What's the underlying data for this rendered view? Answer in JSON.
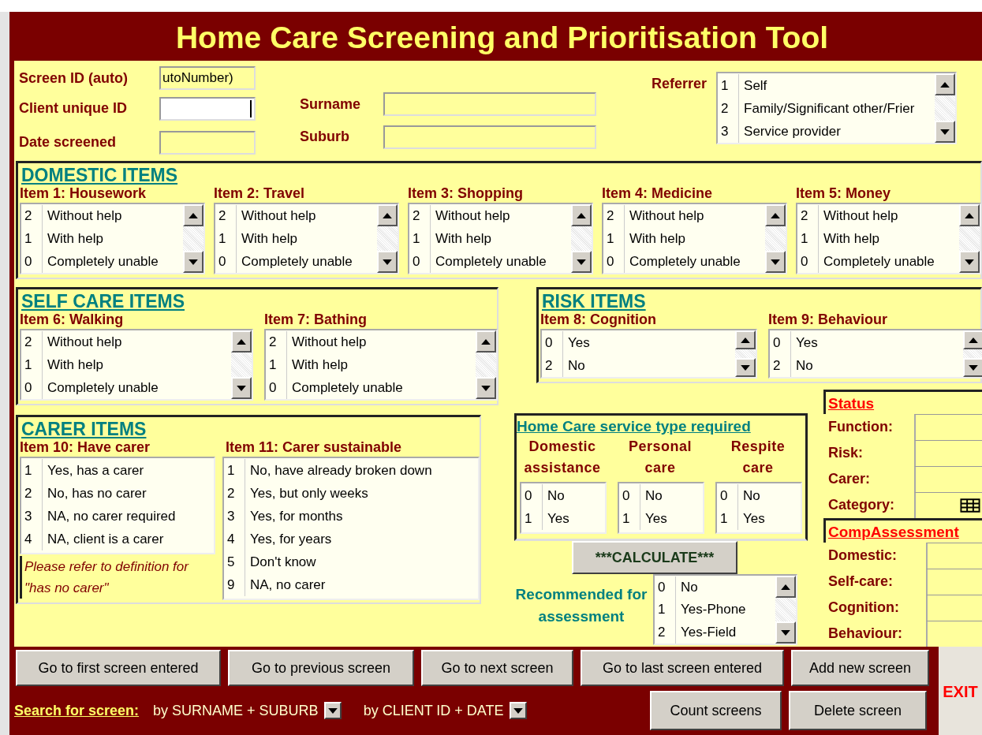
{
  "title": "Home Care Screening and Prioritisation Tool",
  "header": {
    "fields": [
      {
        "label": "Screen ID (auto)",
        "value": "utoNumber)",
        "focused": false
      },
      {
        "label": "Client unique ID",
        "focused": true
      },
      {
        "label": "Date screened",
        "focused": false
      }
    ],
    "name_fields": [
      {
        "label": "Surname"
      },
      {
        "label": "Suburb"
      }
    ],
    "referrer": {
      "label": "Referrer",
      "listbox": {
        "scrollbar": true,
        "options": [
          {
            "code": "1",
            "label": "Self",
            "selected": false
          },
          {
            "code": "2",
            "label": "Family/Significant other/Frier",
            "selected": false
          },
          {
            "code": "3",
            "label": "Service provider",
            "selected": false
          }
        ]
      }
    }
  },
  "domestic": {
    "title": "DOMESTIC ITEMS",
    "items": [
      {
        "label": "Item 1: Housework",
        "listbox": {
          "scrollbar": true,
          "options": [
            {
              "code": "2",
              "label": "Without help",
              "selected": false
            },
            {
              "code": "1",
              "label": "With help",
              "selected": false
            },
            {
              "code": "0",
              "label": "Completely unable",
              "selected": false
            }
          ]
        }
      },
      {
        "label": "Item 2: Travel",
        "listbox": {
          "scrollbar": true,
          "options": [
            {
              "code": "2",
              "label": "Without help",
              "selected": false
            },
            {
              "code": "1",
              "label": "With help",
              "selected": false
            },
            {
              "code": "0",
              "label": "Completely unable",
              "selected": false
            }
          ]
        }
      },
      {
        "label": "Item 3: Shopping",
        "listbox": {
          "scrollbar": true,
          "options": [
            {
              "code": "2",
              "label": "Without help",
              "selected": false
            },
            {
              "code": "1",
              "label": "With help",
              "selected": false
            },
            {
              "code": "0",
              "label": "Completely unable",
              "selected": false
            }
          ]
        }
      },
      {
        "label": "Item 4: Medicine",
        "listbox": {
          "scrollbar": true,
          "options": [
            {
              "code": "2",
              "label": "Without help",
              "selected": false
            },
            {
              "code": "1",
              "label": "With help",
              "selected": false
            },
            {
              "code": "0",
              "label": "Completely unable",
              "selected": false
            }
          ]
        }
      },
      {
        "label": "Item 5: Money",
        "listbox": {
          "scrollbar": true,
          "options": [
            {
              "code": "2",
              "label": "Without help",
              "selected": false
            },
            {
              "code": "1",
              "label": "With help",
              "selected": false
            },
            {
              "code": "0",
              "label": "Completely unable",
              "selected": false
            }
          ]
        }
      }
    ]
  },
  "self_care": {
    "title": "SELF CARE ITEMS",
    "items": [
      {
        "label": "Item 6: Walking",
        "listbox": {
          "scrollbar": true,
          "options": [
            {
              "code": "2",
              "label": "Without help",
              "selected": false
            },
            {
              "code": "1",
              "label": "With help",
              "selected": false
            },
            {
              "code": "0",
              "label": "Completely unable",
              "selected": false
            }
          ]
        }
      },
      {
        "label": "Item 7: Bathing",
        "listbox": {
          "scrollbar": true,
          "options": [
            {
              "code": "2",
              "label": "Without help",
              "selected": false
            },
            {
              "code": "1",
              "label": "With help",
              "selected": false
            },
            {
              "code": "0",
              "label": "Completely unable",
              "selected": false
            }
          ]
        }
      }
    ]
  },
  "risk": {
    "title": "RISK ITEMS",
    "items": [
      {
        "label": "Item 8: Cognition",
        "listbox": {
          "scrollbar": true,
          "options": [
            {
              "code": "0",
              "label": "Yes",
              "selected": false
            },
            {
              "code": "2",
              "label": "No",
              "selected": false
            }
          ]
        }
      },
      {
        "label": "Item 9: Behaviour",
        "listbox": {
          "scrollbar": true,
          "options": [
            {
              "code": "0",
              "label": "Yes",
              "selected": false
            },
            {
              "code": "2",
              "label": "No",
              "selected": false
            }
          ]
        }
      }
    ]
  },
  "carer": {
    "title": "CARER ITEMS",
    "items": [
      {
        "label": "Item 10: Have carer",
        "listbox": {
          "scrollbar": false,
          "options": [
            {
              "code": "1",
              "label": "Yes, has a carer",
              "selected": false
            },
            {
              "code": "2",
              "label": "No, has no carer",
              "selected": false
            },
            {
              "code": "3",
              "label": "NA, no carer required",
              "selected": false
            },
            {
              "code": "4",
              "label": "NA, client is a carer",
              "selected": false
            }
          ]
        }
      },
      {
        "label": "Item 11: Carer sustainable",
        "listbox": {
          "scrollbar": false,
          "options": [
            {
              "code": "1",
              "label": "No, have already broken down",
              "selected": false
            },
            {
              "code": "2",
              "label": "Yes, but only weeks",
              "selected": false
            },
            {
              "code": "3",
              "label": "Yes, for months",
              "selected": false
            },
            {
              "code": "4",
              "label": "Yes, for years",
              "selected": false
            },
            {
              "code": "5",
              "label": "Don't know",
              "selected": false
            },
            {
              "code": "9",
              "label": "NA, no carer",
              "selected": false
            }
          ]
        }
      }
    ],
    "note": "Please refer to definition for \"has no carer\""
  },
  "service_type": {
    "title": "Home Care service type required",
    "columns": [
      {
        "label": "Domestic assistance",
        "listbox": {
          "scrollbar": false,
          "options": [
            {
              "code": "0",
              "label": "No",
              "selected": false
            },
            {
              "code": "1",
              "label": "Yes",
              "selected": false
            }
          ]
        }
      },
      {
        "label": "Personal care",
        "listbox": {
          "scrollbar": false,
          "options": [
            {
              "code": "0",
              "label": "No",
              "selected": false
            },
            {
              "code": "1",
              "label": "Yes",
              "selected": false
            }
          ]
        }
      },
      {
        "label": "Respite care",
        "listbox": {
          "scrollbar": false,
          "options": [
            {
              "code": "0",
              "label": "No",
              "selected": false
            },
            {
              "code": "1",
              "label": "Yes",
              "selected": false
            }
          ]
        }
      }
    ]
  },
  "calculate_button": "***CALCULATE***",
  "recommended": {
    "label": "Recommended for assessment",
    "listbox": {
      "scrollbar": true,
      "options": [
        {
          "code": "0",
          "label": "No",
          "selected": false
        },
        {
          "code": "1",
          "label": "Yes-Phone",
          "selected": false
        },
        {
          "code": "2",
          "label": "Yes-Field",
          "selected": false
        }
      ]
    }
  },
  "status": {
    "title": "Status",
    "fields": [
      {
        "label": "Function:",
        "kind": "text"
      },
      {
        "label": "Risk:",
        "kind": "text"
      },
      {
        "label": "Carer:",
        "kind": "text"
      },
      {
        "label": "Category:",
        "kind": "grid"
      }
    ]
  },
  "comp_assessment": {
    "title": "CompAssessment",
    "fields": [
      {
        "label": "Domestic:",
        "kind": "text"
      },
      {
        "label": "Self-care:",
        "kind": "text"
      },
      {
        "label": "Cognition:",
        "kind": "text"
      },
      {
        "label": "Behaviour:",
        "kind": "text"
      }
    ]
  },
  "footer": {
    "nav_buttons": [
      "Go to first screen entered",
      "Go to previous screen",
      "Go to next screen",
      "Go to last screen entered",
      "Add new screen"
    ],
    "search": {
      "label": "Search for screen:",
      "options": [
        {
          "label": "by SURNAME + SUBURB"
        },
        {
          "label": "by CLIENT ID + DATE"
        }
      ]
    },
    "action_buttons": [
      "Count screens",
      "Delete screen"
    ],
    "exit": "EXIT"
  }
}
